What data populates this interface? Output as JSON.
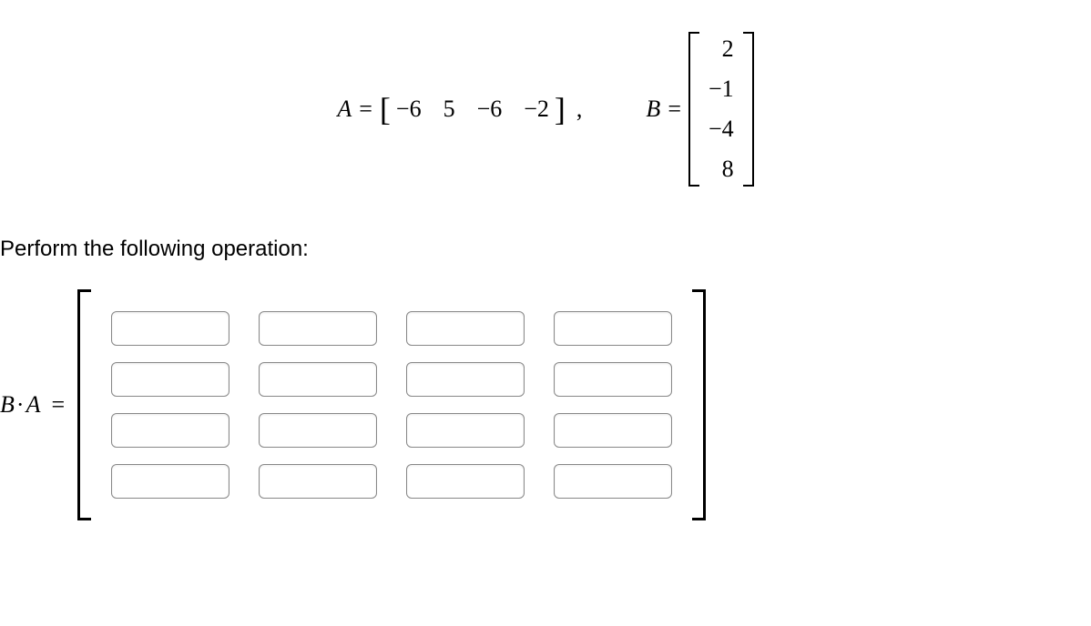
{
  "equationA": {
    "varLabel": "A",
    "eq": "=",
    "values": [
      "−6",
      "5",
      "−6",
      "−2"
    ],
    "trail": ","
  },
  "equationB": {
    "varLabel": "B",
    "eq": "=",
    "values": [
      "2",
      "−1",
      "−4",
      "8"
    ]
  },
  "instruction": "Perform the following operation:",
  "answer": {
    "lhsLeft": "B",
    "dot": "·",
    "lhsRight": "A",
    "eq": "=",
    "rows": 4,
    "cols": 4
  }
}
